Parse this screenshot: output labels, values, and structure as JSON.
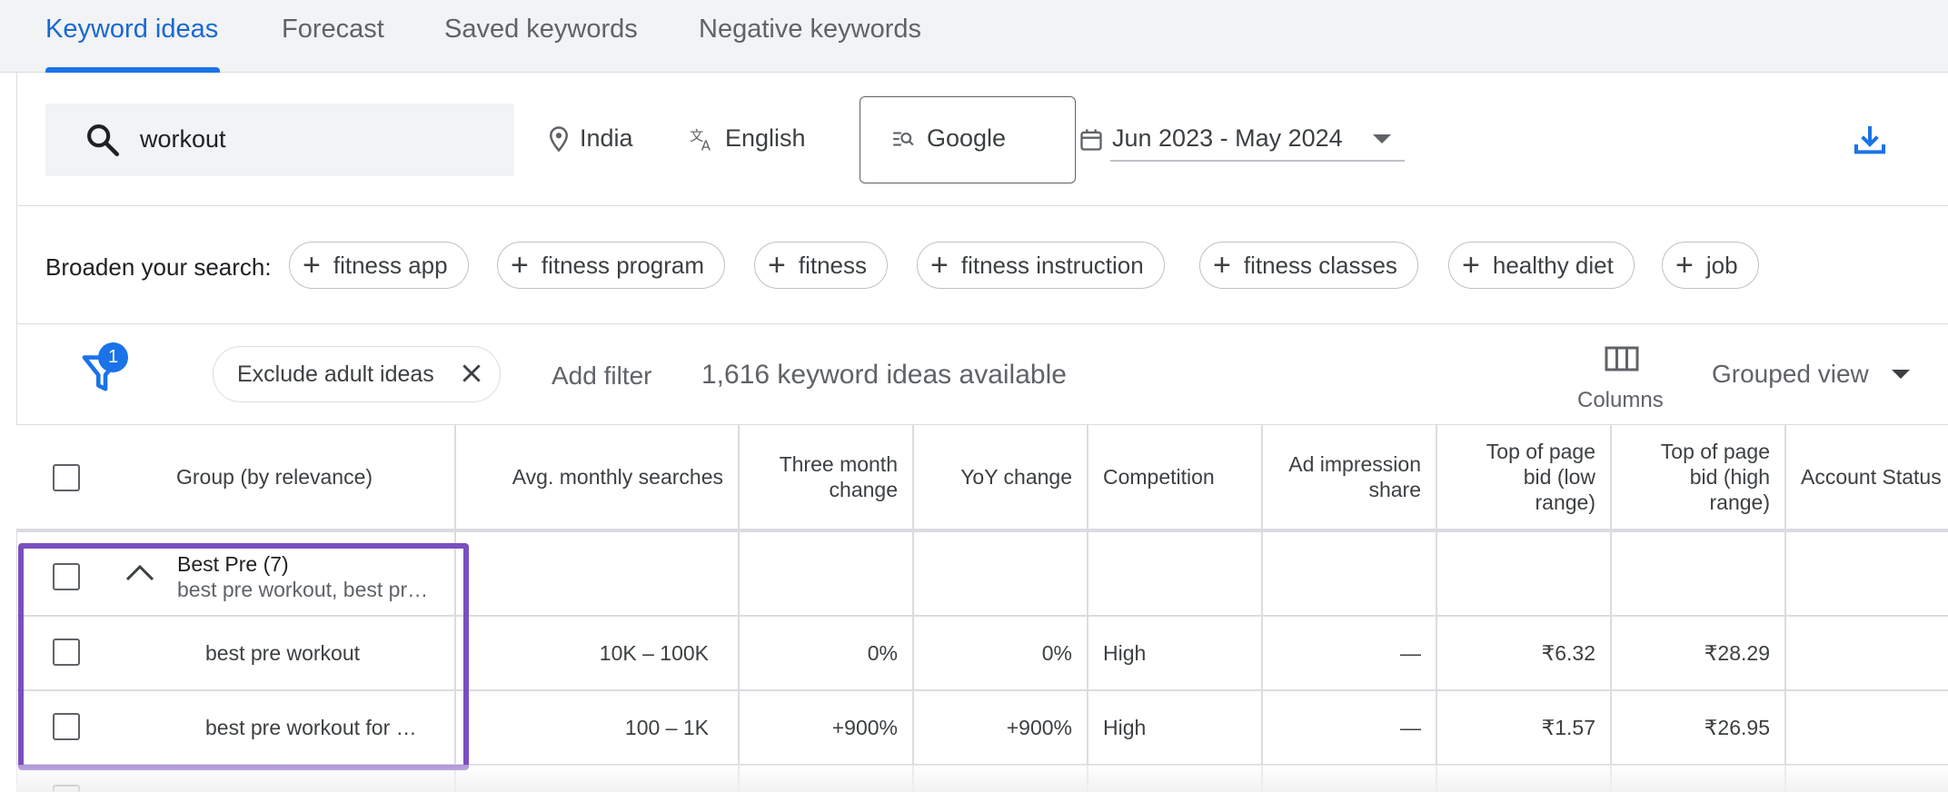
{
  "tabs": [
    {
      "label": "Keyword ideas",
      "active": true
    },
    {
      "label": "Forecast",
      "active": false
    },
    {
      "label": "Saved keywords",
      "active": false
    },
    {
      "label": "Negative keywords",
      "active": false
    }
  ],
  "search": {
    "value": "workout",
    "location": "India",
    "language": "English",
    "engine": "Google",
    "date_range": "Jun 2023 - May 2024"
  },
  "broaden": {
    "label": "Broaden your search:",
    "chips": [
      "fitness app",
      "fitness program",
      "fitness",
      "fitness instruction",
      "fitness classes",
      "healthy diet",
      "job"
    ]
  },
  "filters": {
    "badge_count": "1",
    "exclude_label": "Exclude adult ideas",
    "add_filter": "Add filter",
    "ideas_available": "1,616 keyword ideas available",
    "columns_label": "Columns",
    "view_label": "Grouped view"
  },
  "table": {
    "headers": {
      "group": "Group (by relevance)",
      "avg": "Avg. monthly searches",
      "three_month": "Three month change",
      "yoy": "YoY change",
      "competition": "Competition",
      "ad_share": "Ad impression share",
      "bid_low": "Top of page bid (low range)",
      "bid_high": "Top of page bid (high range)",
      "account_status": "Account Status"
    },
    "group_row": {
      "title": "Best Pre (7)",
      "subtitle": "best pre workout, best pr…"
    },
    "rows": [
      {
        "keyword": "best pre workout",
        "avg": "10K – 100K",
        "three_month": "0%",
        "yoy": "0%",
        "competition": "High",
        "ad_share": "—",
        "bid_low": "₹6.32",
        "bid_high": "₹28.29"
      },
      {
        "keyword": "best pre workout for …",
        "avg": "100 – 1K",
        "three_month": "+900%",
        "yoy": "+900%",
        "competition": "High",
        "ad_share": "—",
        "bid_low": "₹1.57",
        "bid_high": "₹26.95"
      }
    ]
  },
  "colors": {
    "accent": "#1a73e8",
    "highlight": "#7b4fbf"
  }
}
